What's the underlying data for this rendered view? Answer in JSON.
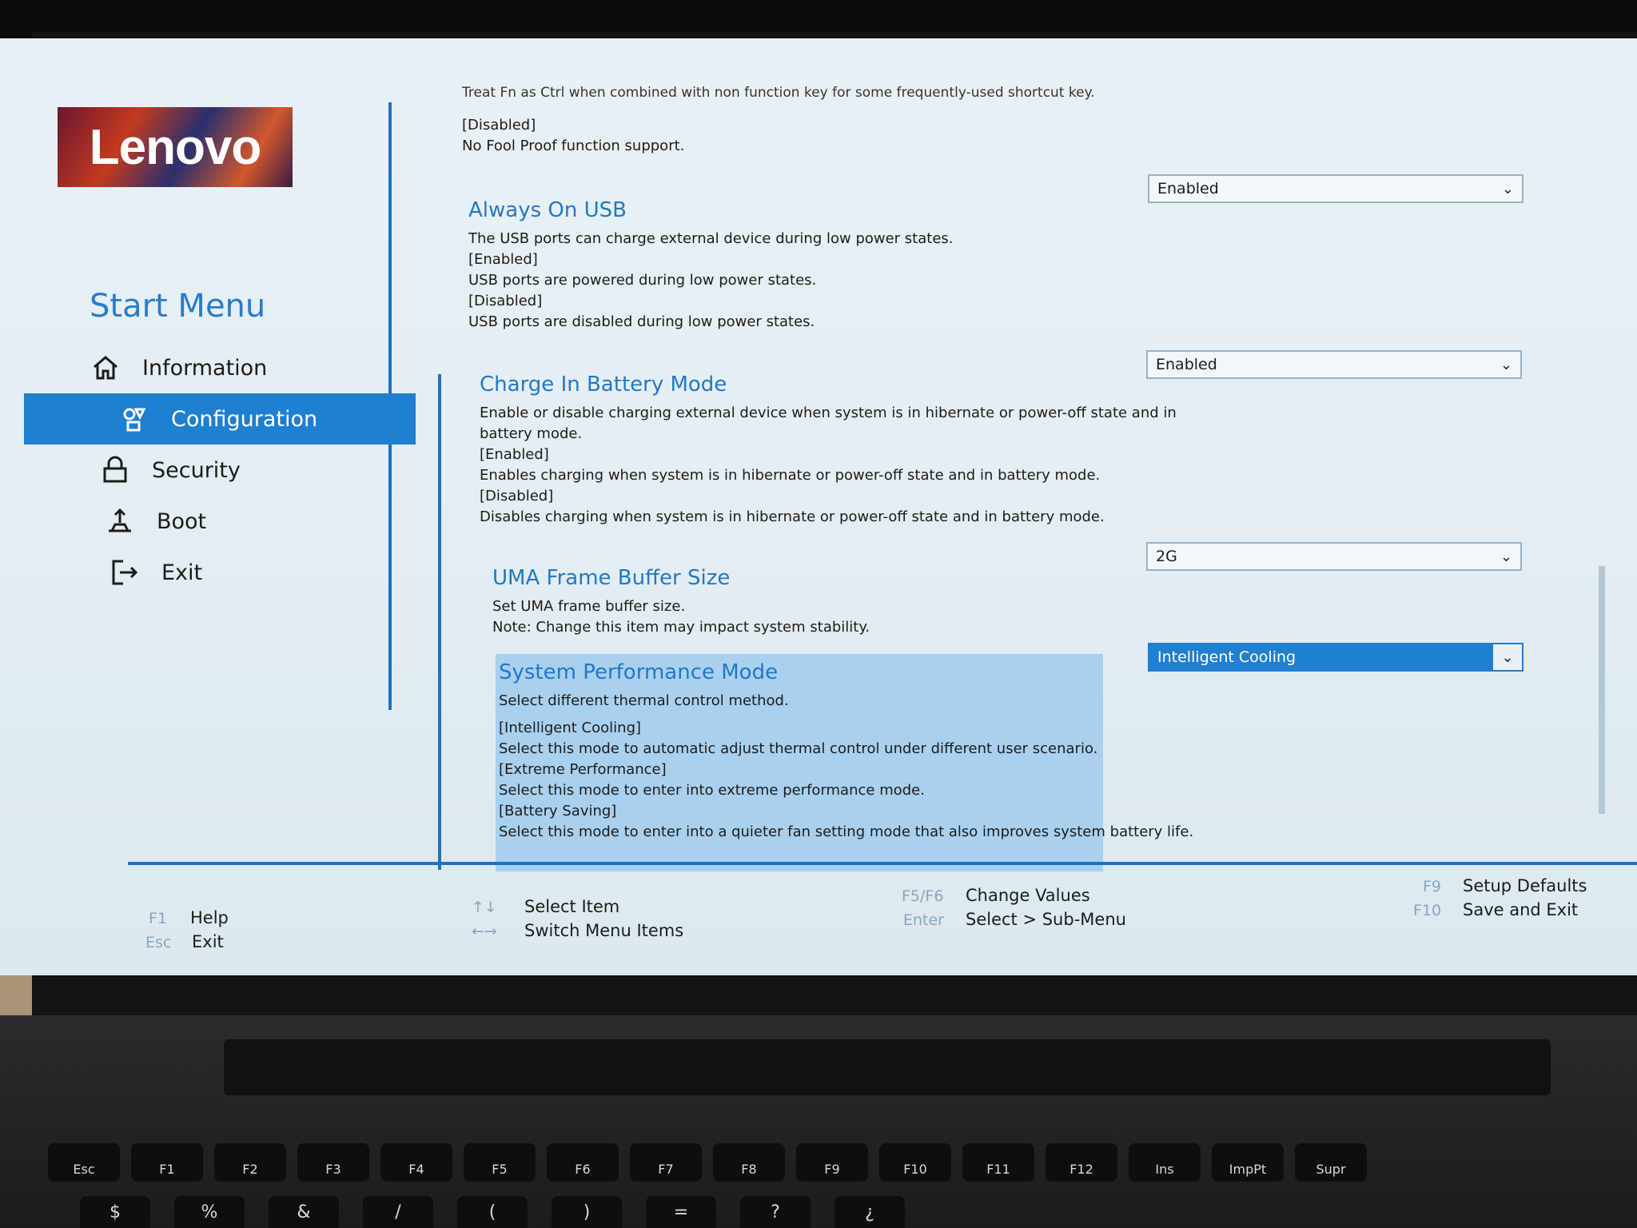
{
  "brand": {
    "logo_text": "Lenovo"
  },
  "sidebar": {
    "title": "Start Menu",
    "items": [
      {
        "label": "Information",
        "icon": "home-icon",
        "active": false
      },
      {
        "label": "Configuration",
        "icon": "configuration-icon",
        "active": true
      },
      {
        "label": "Security",
        "icon": "lock-icon",
        "active": false
      },
      {
        "label": "Boot",
        "icon": "boot-icon",
        "active": false
      },
      {
        "label": "Exit",
        "icon": "exit-icon",
        "active": false
      }
    ]
  },
  "settings": {
    "previous": {
      "cutoff_line": "Treat Fn as Ctrl when combined with non function key for some frequently-used shortcut key.",
      "option": "[Disabled]",
      "option_desc": "No Fool Proof function support."
    },
    "always_on_usb": {
      "title": "Always On USB",
      "desc": "The USB ports can charge external device during low power states.",
      "opt1": "[Enabled]",
      "opt1_desc": "USB ports are powered during low power states.",
      "opt2": "[Disabled]",
      "opt2_desc": "USB ports are disabled during low power states.",
      "value": "Enabled"
    },
    "charge_in_battery": {
      "title": "Charge In Battery Mode",
      "desc1": "Enable or disable charging external device when system is in hibernate or power-off state and in",
      "desc2": "battery mode.",
      "opt1": "[Enabled]",
      "opt1_desc": "Enables charging when system is in hibernate or power-off state and in battery mode.",
      "opt2": "[Disabled]",
      "opt2_desc": "Disables charging when system is in hibernate or power-off state and in battery mode.",
      "value": "Enabled"
    },
    "uma": {
      "title": "UMA Frame Buffer Size",
      "desc1": "Set UMA frame buffer size.",
      "desc2": "Note: Change this item may impact system stability.",
      "value": "2G"
    },
    "performance": {
      "title": "System Performance Mode",
      "desc": "Select different thermal control method.",
      "opt1": "[Intelligent Cooling]",
      "opt1_desc": "Select this mode to automatic adjust thermal control under different user scenario.",
      "opt2": "[Extreme Performance]",
      "opt2_desc": "Select this mode to enter into extreme performance mode.",
      "opt3": "[Battery Saving]",
      "opt3_desc": "Select this mode to enter into a quieter fan setting mode that also improves system battery life.",
      "value": "Intelligent Cooling"
    }
  },
  "footer": {
    "f1_key": "F1",
    "f1_label": "Help",
    "esc_key": "Esc",
    "esc_label": "Exit",
    "arrows_ud": "↑↓",
    "select_item": "Select Item",
    "arrows_lr": "←→",
    "switch_menu": "Switch Menu Items",
    "f5f6_key": "F5/F6",
    "change_values": "Change Values",
    "enter_key": "Enter",
    "select_sub": "Select > Sub-Menu",
    "f9_key": "F9",
    "setup_defaults": "Setup Defaults",
    "f10_key": "F10",
    "save_exit": "Save and Exit"
  },
  "keyboard": {
    "row1": [
      "Esc",
      "F1",
      "F2",
      "F3",
      "F4",
      "F5",
      "F6",
      "F7",
      "F8",
      "F9",
      "F10",
      "F11",
      "F12",
      "Ins",
      "ImpPt",
      "Supr"
    ],
    "row2": [
      "$",
      "%",
      "&",
      "/",
      "(",
      ")",
      "=",
      "?",
      "¿"
    ]
  },
  "colors": {
    "accent": "#1f7fd0",
    "title_blue": "#2278c6",
    "highlight_bg": "#a9d0ee",
    "screen_bg": "#e6eff5"
  }
}
